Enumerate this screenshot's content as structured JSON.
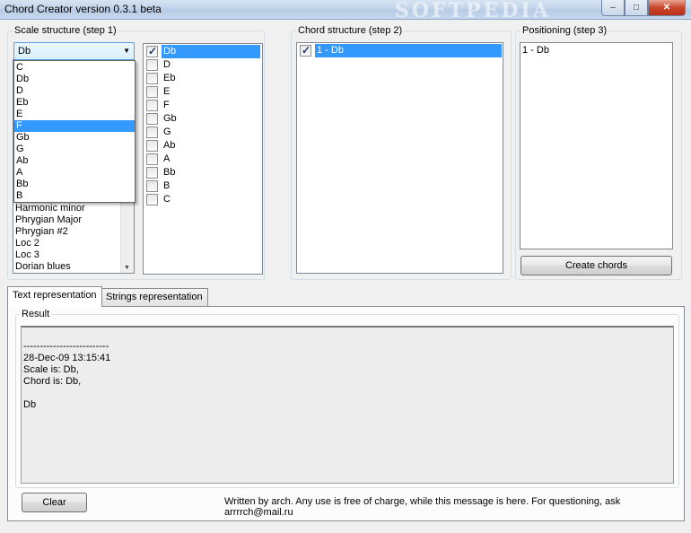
{
  "window": {
    "title": "Chord Creator version 0.3.1 beta",
    "watermark": "SOFTPEDIA",
    "controls": {
      "minimize": "–",
      "maximize": "□",
      "close": "✕"
    }
  },
  "scale_group": {
    "label": "Scale structure (step 1)",
    "root_select": {
      "value": "Db",
      "arrow": "▼"
    },
    "root_options": [
      "C",
      "Db",
      "D",
      "Eb",
      "E",
      "F",
      "Gb",
      "G",
      "Ab",
      "A",
      "Bb",
      "B"
    ],
    "highlighted_option": "F",
    "scale_list_visible": [
      "Harmonic minor",
      "Phrygian Major",
      "Phrygian #2",
      "Loc 2",
      "Loc 3",
      "Dorian blues"
    ],
    "scroll_arrow": "▼",
    "notes": [
      {
        "label": "Db",
        "checked": true,
        "selected": true
      },
      {
        "label": "D",
        "checked": false
      },
      {
        "label": "Eb",
        "checked": false
      },
      {
        "label": "E",
        "checked": false
      },
      {
        "label": "F",
        "checked": false
      },
      {
        "label": "Gb",
        "checked": false
      },
      {
        "label": "G",
        "checked": false
      },
      {
        "label": "Ab",
        "checked": false
      },
      {
        "label": "A",
        "checked": false
      },
      {
        "label": "Bb",
        "checked": false
      },
      {
        "label": "B",
        "checked": false
      },
      {
        "label": "C",
        "checked": false
      }
    ]
  },
  "chord_group": {
    "label": "Chord structure (step 2)",
    "items": [
      {
        "label": "1 - Db",
        "checked": true,
        "selected": true
      }
    ]
  },
  "positioning_group": {
    "label": "Positioning (step 3)",
    "items": [
      "1 - Db"
    ],
    "create_button": "Create chords"
  },
  "tabs": [
    "Text representation",
    "Strings representation"
  ],
  "result": {
    "label": "Result",
    "lines": [
      "",
      "--------------------------",
      "28-Dec-09 13:15:41",
      "Scale is: Db,",
      "Chord is: Db,",
      "",
      "Db"
    ]
  },
  "footer": {
    "clear_button": "Clear",
    "message": "Written by arch. Any use is free of charge, while this message is here. For questioning, ask arrrrch@mail.ru"
  },
  "colors": {
    "selection": "#3399ff",
    "window_bg": "#f0f0f0"
  }
}
